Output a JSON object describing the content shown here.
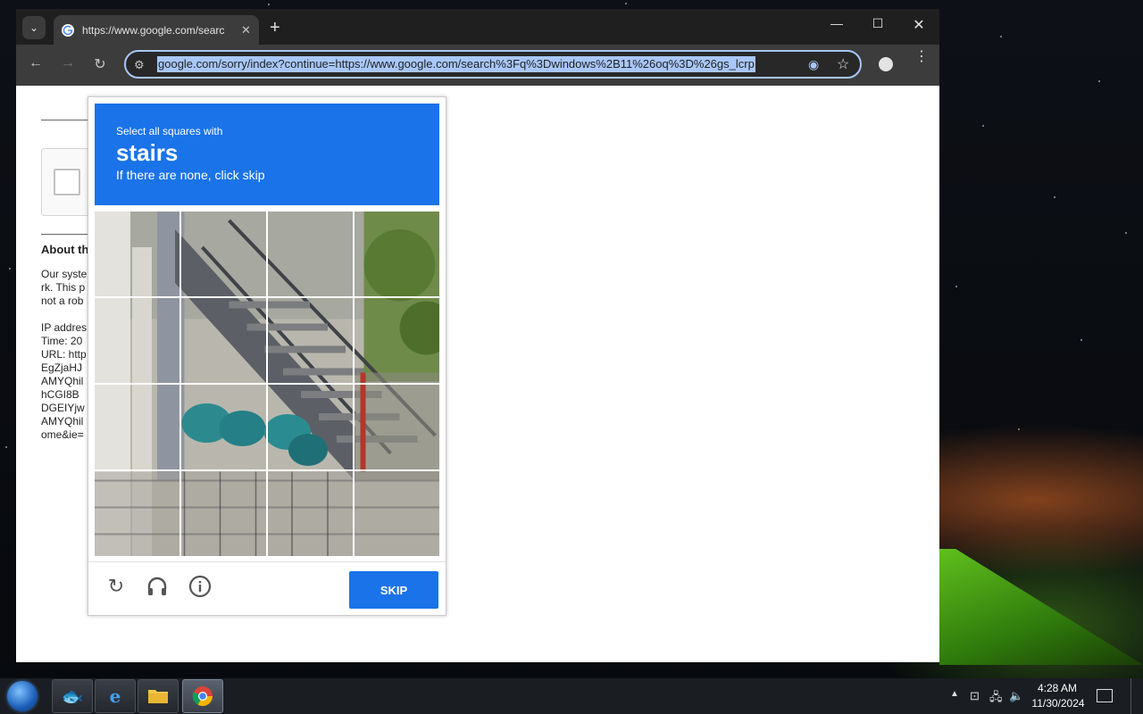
{
  "browser": {
    "tab_title": "https://www.google.com/searc",
    "address_url": "google.com/sorry/index?continue=https://www.google.com/search%3Fq%3Dwindows%2B11%26oq%3D%26gs_lcrp"
  },
  "page": {
    "about_title": "About th",
    "lines": [
      "Our syste",
      "rk. This p",
      "not a rob",
      "",
      "IP addres",
      "Time: 20",
      "URL: http",
      "EgZjaHJ",
      "AMYQhil",
      "hCGI8B",
      "DGEIYjw",
      "AMYQhil",
      "ome&ie="
    ]
  },
  "captcha": {
    "instruction_line1": "Select all squares with",
    "keyword": "stairs",
    "instruction_line3": "If there are none, click skip",
    "skip_label": "SKIP",
    "tiles": 16
  },
  "taskbar": {
    "time": "4:28 AM",
    "date": "11/30/2024"
  },
  "colors": {
    "captcha_blue": "#1a73e8",
    "tab_bar": "#1f1f1f",
    "toolbar": "#3c3c3c",
    "url_highlight": "#a8c7fa"
  }
}
